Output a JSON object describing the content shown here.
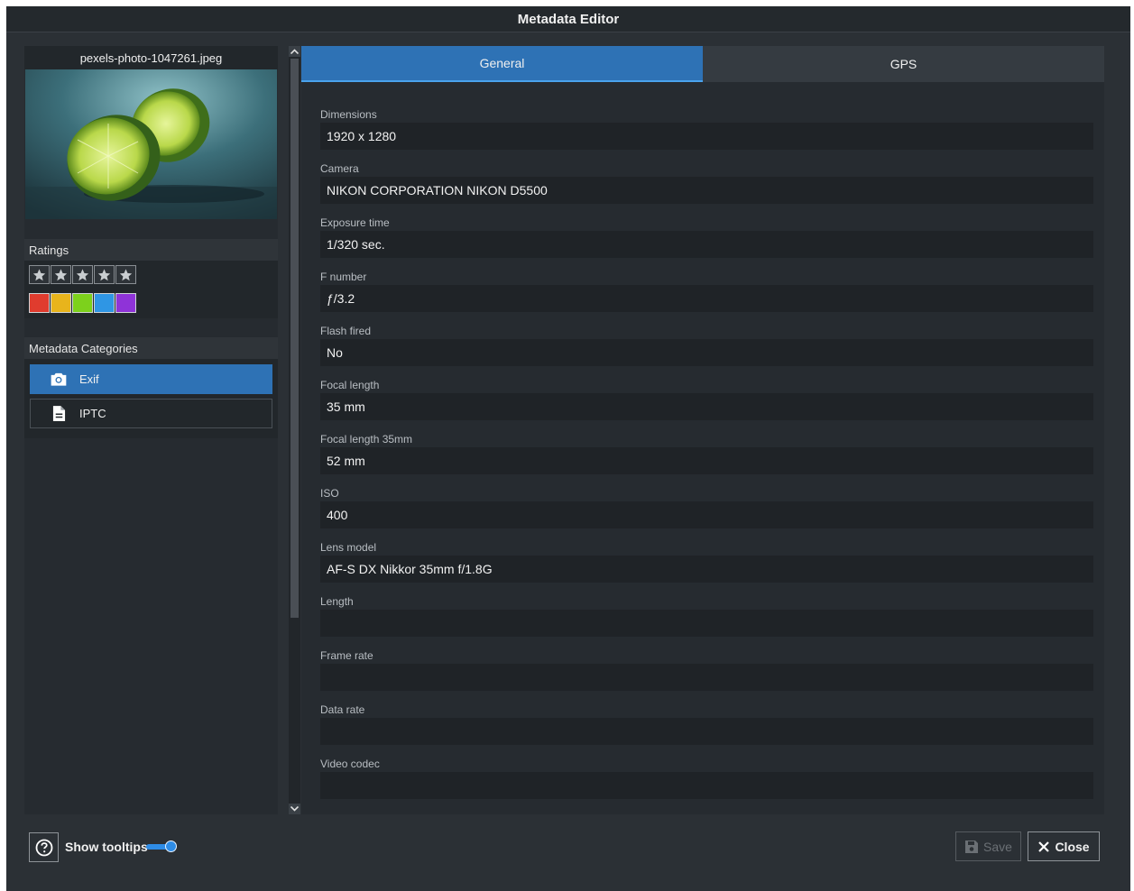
{
  "window": {
    "title": "Metadata Editor"
  },
  "image": {
    "filename": "pexels-photo-1047261.jpeg"
  },
  "ratings": {
    "label": "Ratings",
    "stars": {
      "filled": 0,
      "max": 5
    },
    "colors": [
      "#e03c2e",
      "#e8b41c",
      "#7dd11c",
      "#2f96e4",
      "#8f33d8"
    ]
  },
  "categories": {
    "label": "Metadata Categories",
    "items": [
      {
        "label": "Exif",
        "icon": "camera-icon",
        "active": true
      },
      {
        "label": "IPTC",
        "icon": "document-icon",
        "active": false
      }
    ]
  },
  "tabs": [
    {
      "label": "General",
      "active": true
    },
    {
      "label": "GPS",
      "active": false
    }
  ],
  "fields": [
    {
      "label": "Dimensions",
      "value": "1920 x 1280"
    },
    {
      "label": "Camera",
      "value": "NIKON CORPORATION NIKON D5500"
    },
    {
      "label": "Exposure time",
      "value": "1/320 sec."
    },
    {
      "label": "F number",
      "value": "ƒ/3.2"
    },
    {
      "label": "Flash fired",
      "value": "No"
    },
    {
      "label": "Focal length",
      "value": "35 mm"
    },
    {
      "label": "Focal length 35mm",
      "value": "52 mm"
    },
    {
      "label": "ISO",
      "value": "400"
    },
    {
      "label": "Lens model",
      "value": "AF-S DX Nikkor 35mm f/1.8G"
    },
    {
      "label": "Length",
      "value": ""
    },
    {
      "label": "Frame rate",
      "value": ""
    },
    {
      "label": "Data rate",
      "value": ""
    },
    {
      "label": "Video codec",
      "value": ""
    }
  ],
  "footer": {
    "tooltips_label": "Show tooltips",
    "tooltips_enabled": true,
    "save_label": "Save",
    "close_label": "Close"
  },
  "accent_color": "#2e72b5"
}
